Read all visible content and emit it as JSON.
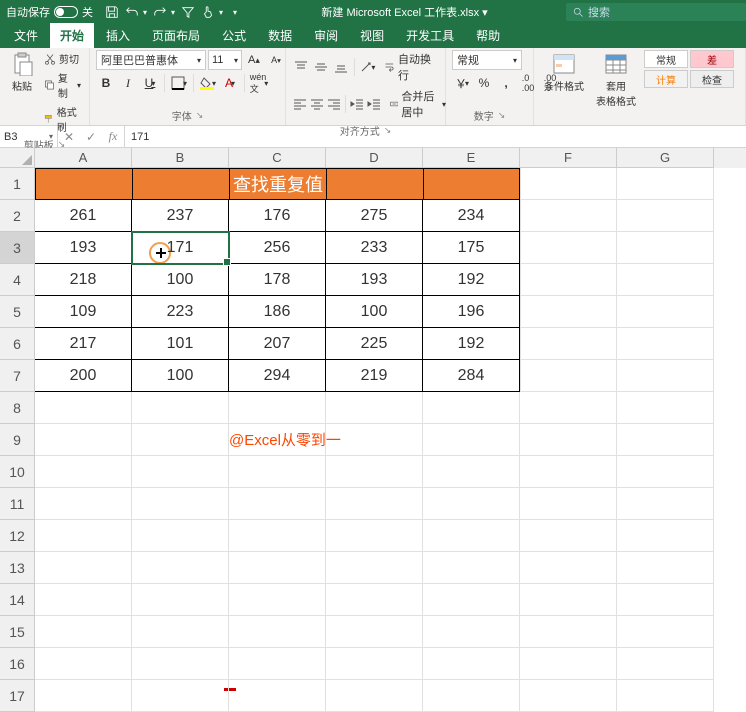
{
  "titlebar": {
    "autosave": "自动保存",
    "autosave_state": "关",
    "doc_title": "新建 Microsoft Excel 工作表.xlsx ▾",
    "search_placeholder": "搜索"
  },
  "tabs": {
    "file": "文件",
    "home": "开始",
    "insert": "插入",
    "layout": "页面布局",
    "formulas": "公式",
    "data": "数据",
    "review": "审阅",
    "view": "视图",
    "dev": "开发工具",
    "help": "帮助"
  },
  "ribbon": {
    "paste": "粘贴",
    "cut": "剪切",
    "copy": "复制",
    "fmtpainter": "格式刷",
    "clipboard_label": "剪贴板",
    "fontname": "阿里巴巴普惠体",
    "fontsize": "11",
    "font_label": "字体",
    "wrap": "自动换行",
    "merge": "合并后居中",
    "align_label": "对齐方式",
    "numfmt": "常规",
    "num_label": "数字",
    "condfmt": "条件格式",
    "tablefmt": "套用\n表格格式",
    "style_normal": "常规",
    "style_bad": "差",
    "style_calc": "计算",
    "style_check": "检查"
  },
  "fbar": {
    "cellref": "B3",
    "formula": "171"
  },
  "grid": {
    "cols": [
      "A",
      "B",
      "C",
      "D",
      "E",
      "F",
      "G"
    ],
    "rows": [
      "1",
      "2",
      "3",
      "4",
      "5",
      "6",
      "7",
      "8",
      "9",
      "10",
      "11",
      "12",
      "13",
      "14",
      "15",
      "16",
      "17"
    ],
    "title_merged": "查找重复值",
    "data": [
      [
        "261",
        "237",
        "176",
        "275",
        "234"
      ],
      [
        "193",
        "171",
        "256",
        "233",
        "175"
      ],
      [
        "218",
        "100",
        "178",
        "193",
        "192"
      ],
      [
        "109",
        "223",
        "186",
        "100",
        "196"
      ],
      [
        "217",
        "101",
        "207",
        "225",
        "192"
      ],
      [
        "200",
        "100",
        "294",
        "219",
        "284"
      ]
    ],
    "watermark": "@Excel从零到一",
    "selected": "B3"
  }
}
